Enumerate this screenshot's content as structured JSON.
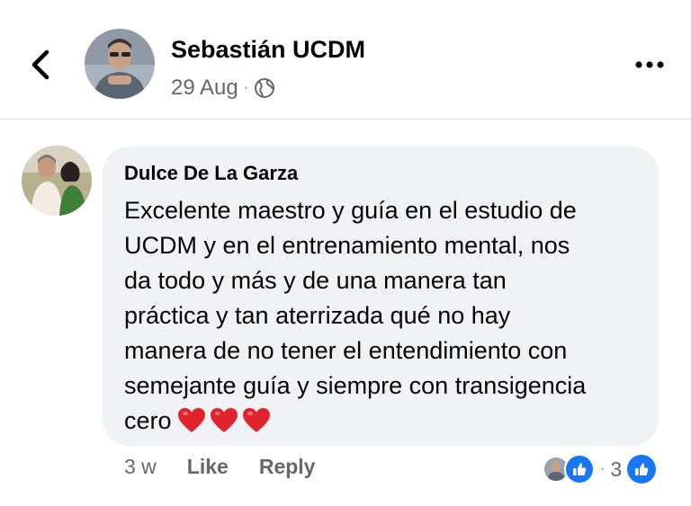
{
  "post": {
    "author": "Sebastián UCDM",
    "date": "29 Aug",
    "separator": "·",
    "audience_icon": "globe-icon"
  },
  "comment": {
    "author": "Dulce De La Garza",
    "lines": [
      "Excelente maestro y guía en el estudio de",
      "UCDM y en el entrenamiento mental, nos",
      "da todo y más y de una manera tan",
      "práctica y tan aterrizada qué no hay",
      "manera de no tener el entendimiento con",
      "semejante guía y siempre con transigencia",
      "cero"
    ],
    "emoji": [
      "heart-emoji",
      "heart-emoji",
      "heart-emoji"
    ],
    "time_ago": "3 w",
    "like_label": "Like",
    "reply_label": "Reply",
    "reaction_separator": "·",
    "reaction_count": "3"
  },
  "colors": {
    "accent_blue": "#1877f2",
    "bubble_bg": "#f0f2f5",
    "secondary_text": "#65676b",
    "heart_red": "#e0242e"
  }
}
